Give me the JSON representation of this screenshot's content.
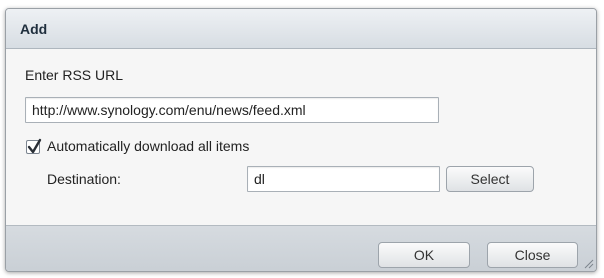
{
  "dialog": {
    "title": "Add",
    "rss_label": "Enter RSS URL",
    "rss_url": "http://www.synology.com/enu/news/feed.xml",
    "auto_download": {
      "checked": true,
      "label": "Automatically download all items"
    },
    "destination": {
      "label": "Destination:",
      "value": "dl",
      "select_label": "Select"
    },
    "buttons": {
      "ok": "OK",
      "close": "Close"
    }
  },
  "icons": [
    "checkmark-icon",
    "resize-grip-icon"
  ],
  "colors": {
    "title_text": "#1f2e3d",
    "footer_bg": "#c9cfd5"
  }
}
